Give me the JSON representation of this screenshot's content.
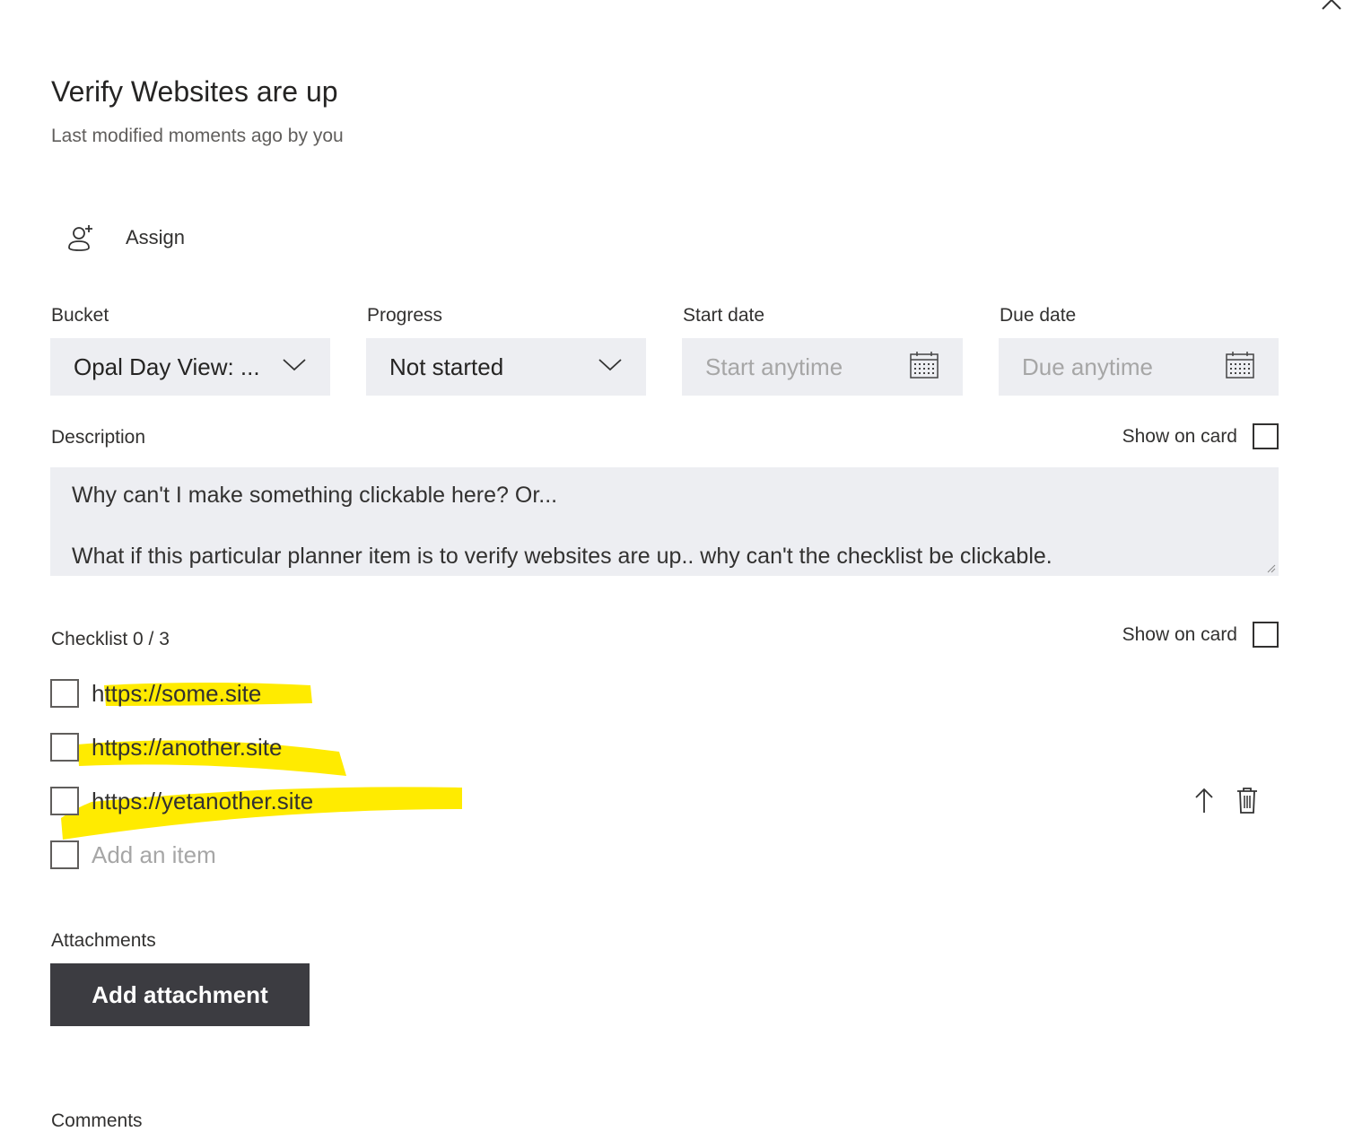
{
  "task": {
    "title": "Verify Websites are up",
    "modified": "Last modified moments ago by you"
  },
  "assign": {
    "label": "Assign"
  },
  "fields": {
    "bucket": {
      "label": "Bucket",
      "value": "Opal Day View: ..."
    },
    "progress": {
      "label": "Progress",
      "value": "Not started"
    },
    "start_date": {
      "label": "Start date",
      "placeholder": "Start anytime"
    },
    "due_date": {
      "label": "Due date",
      "placeholder": "Due anytime"
    }
  },
  "description": {
    "label": "Description",
    "show_on_card": "Show on card",
    "line1": "Why can't I make something clickable here? Or...",
    "line2": "What if this particular planner item is to verify websites are up.. why can't the checklist be clickable."
  },
  "checklist": {
    "label": "Checklist 0 / 3",
    "show_on_card": "Show on card",
    "items": [
      {
        "text": "https://some.site",
        "checked": false
      },
      {
        "text": "https://another.site",
        "checked": false
      },
      {
        "text": "https://yetanother.site",
        "checked": false
      }
    ],
    "add_placeholder": "Add an item"
  },
  "attachments": {
    "label": "Attachments",
    "button": "Add attachment"
  },
  "comments": {
    "label": "Comments"
  },
  "colors": {
    "highlight": "#ffeb00",
    "field_bg": "#edeef2",
    "button_bg": "#3c3c41"
  },
  "icons": {
    "close": "close-icon",
    "assign": "add-person-icon",
    "dropdown": "chevron-down-icon",
    "calendar": "calendar-icon",
    "move_up": "arrow-up-icon",
    "delete": "trash-icon"
  }
}
